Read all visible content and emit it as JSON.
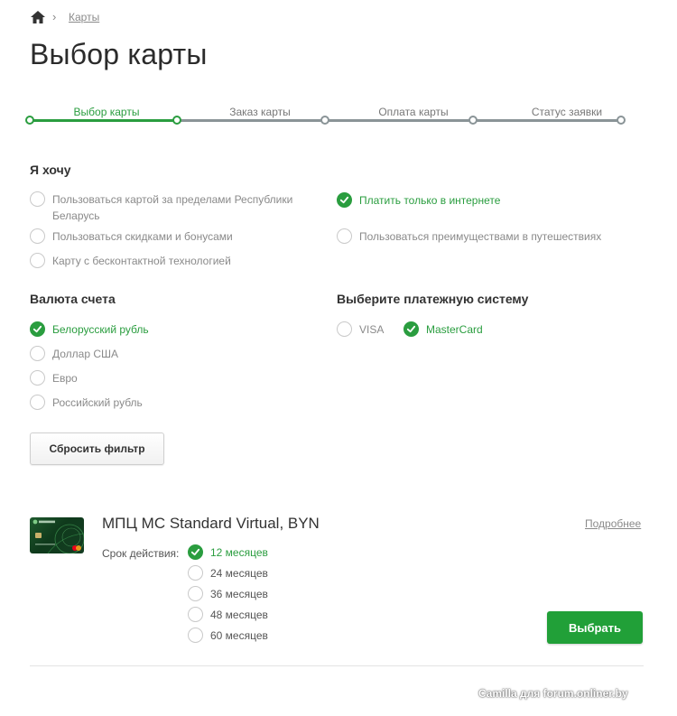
{
  "breadcrumb": {
    "current": "Карты"
  },
  "page_title": "Выбор карты",
  "stepper": {
    "steps": [
      "Выбор карты",
      "Заказ карты",
      "Оплата карты",
      "Статус заявки"
    ],
    "active_step": 1
  },
  "want": {
    "title": "Я хочу",
    "options_left": [
      {
        "label_line1": "Пользоваться картой за пределами Республики",
        "label_line2": "Беларусь",
        "checked": false
      },
      {
        "label": "Пользоваться скидками и бонусами",
        "checked": false
      },
      {
        "label": "Карту с бесконтактной технологией",
        "checked": false
      }
    ],
    "options_right": [
      {
        "label": "Платить только в интернете",
        "checked": true
      },
      {
        "label": "Пользоваться преимуществами в путешествиях",
        "checked": false
      }
    ]
  },
  "currency": {
    "title": "Валюта счета",
    "options": [
      {
        "label": "Белорусский рубль",
        "checked": true
      },
      {
        "label": "Доллар США",
        "checked": false
      },
      {
        "label": "Евро",
        "checked": false
      },
      {
        "label": "Российский рубль",
        "checked": false
      }
    ]
  },
  "payment_system": {
    "title": "Выберите платежную систему",
    "options": [
      {
        "label": "VISA",
        "checked": false
      },
      {
        "label": "MasterCard",
        "checked": true
      }
    ]
  },
  "reset_button": "Сбросить фильтр",
  "card": {
    "title": "МПЦ MC Standard Virtual, BYN",
    "more_link": "Подробнее",
    "validity_label": "Срок действия:",
    "terms": [
      {
        "label": "12 месяцев",
        "checked": true
      },
      {
        "label": "24 месяцев",
        "checked": false
      },
      {
        "label": "36 месяцев",
        "checked": false
      },
      {
        "label": "48 месяцев",
        "checked": false
      },
      {
        "label": "60 месяцев",
        "checked": false
      }
    ],
    "choose_button": "Выбрать"
  },
  "watermark": "Camilla для forum.onliner.by",
  "colors": {
    "accent": "#21a038",
    "step_gray": "#8a9497",
    "muted_text": "#8a8a8a"
  }
}
